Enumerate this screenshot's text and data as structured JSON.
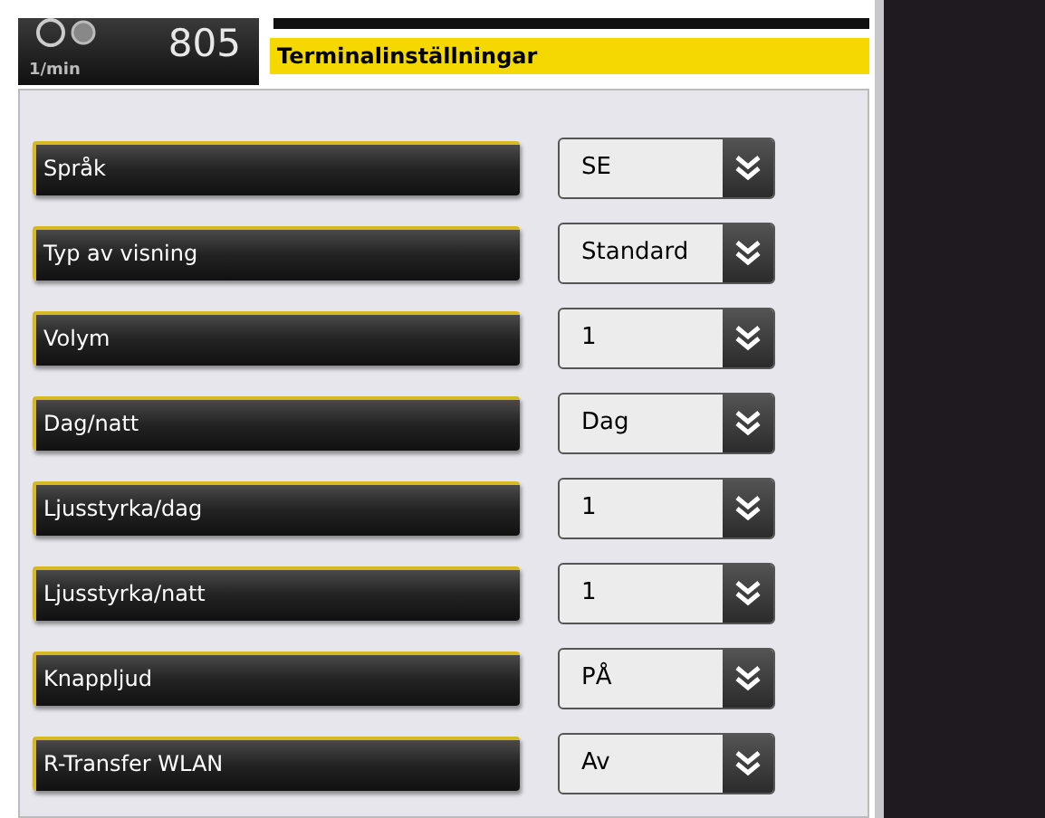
{
  "header": {
    "unit": "1/min",
    "value": "805",
    "title": "Terminalinställningar"
  },
  "settings": [
    {
      "label": "Språk",
      "value": "SE"
    },
    {
      "label": "Typ av visning",
      "value": "Standard"
    },
    {
      "label": "Volym",
      "value": "1"
    },
    {
      "label": "Dag/natt",
      "value": "Dag"
    },
    {
      "label": "Ljusstyrka/dag",
      "value": "1"
    },
    {
      "label": "Ljusstyrka/natt",
      "value": "1"
    },
    {
      "label": "Knappljud",
      "value": "PÅ"
    },
    {
      "label": "R-Transfer WLAN",
      "value": "Av"
    }
  ]
}
